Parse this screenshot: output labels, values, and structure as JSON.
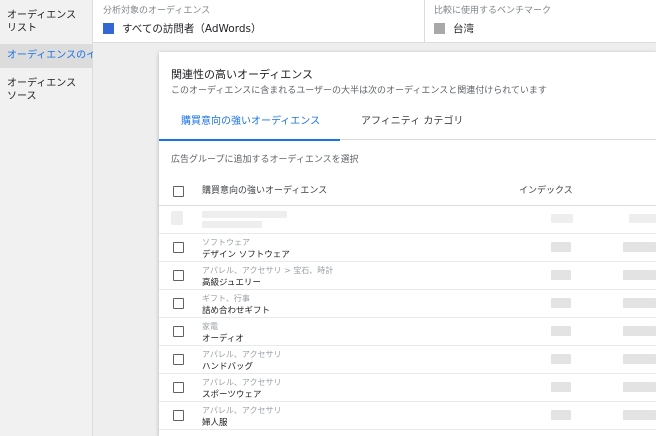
{
  "left_nav": {
    "items": [
      {
        "label": "オーディエンス\nリスト"
      },
      {
        "label": "オーディエンスのイ"
      },
      {
        "label": "オーディエンス\nソース"
      }
    ]
  },
  "top_bar": {
    "audience_label": "分析対象のオーディエンス",
    "audience_value": "すべての訪問者（AdWords）",
    "audience_color": "#3367d6",
    "benchmark_label": "比較に使用するベンチマーク",
    "benchmark_value": "台湾",
    "benchmark_color": "#a9a9a9"
  },
  "card": {
    "title": "関連性の高いオーディエンス",
    "subtitle": "このオーディエンスに含まれるユーザーの大半は次のオーディエンスと関連付けられています",
    "tabs": [
      {
        "label": "購買意向の強いオーディエンス"
      },
      {
        "label": "アフィニティ カテゴリ"
      }
    ],
    "hint": "広告グループに追加するオーディエンスを選択",
    "table": {
      "columns": [
        "購買意向の強いオーディエンス",
        "インデックス"
      ],
      "rows": [
        {
          "category": "",
          "name": ""
        },
        {
          "category": "ソフトウェア",
          "name": "デザイン ソフトウェア"
        },
        {
          "category": "アパレル、アクセサリ > 宝石、時計",
          "name": "高級ジュエリー"
        },
        {
          "category": "ギフト、行事",
          "name": "詰め合わせギフト"
        },
        {
          "category": "家電",
          "name": "オーディオ"
        },
        {
          "category": "アパレル、アクセサリ",
          "name": "ハンドバッグ"
        },
        {
          "category": "アパレル、アクセサリ",
          "name": "スポーツウェア"
        },
        {
          "category": "アパレル、アクセサリ",
          "name": "婦人服"
        }
      ]
    }
  },
  "colors": {
    "accent": "#1a73e8",
    "selected_nav_bg": "#dcdcdc"
  }
}
